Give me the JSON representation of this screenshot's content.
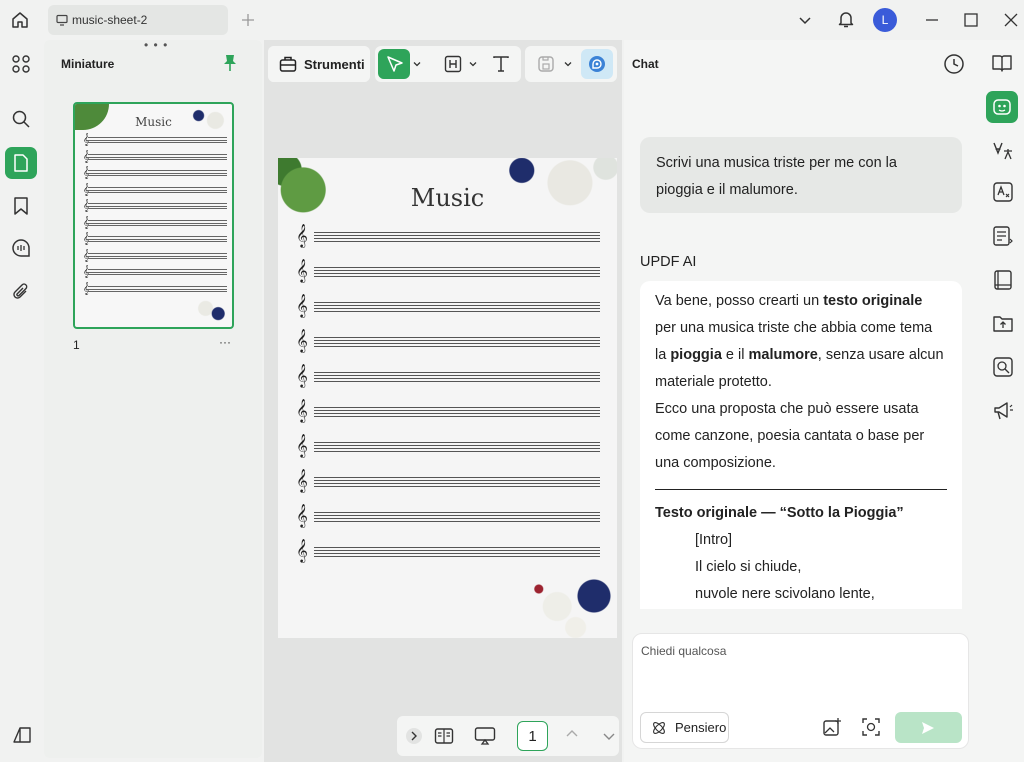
{
  "tab": {
    "title": "music-sheet-2"
  },
  "thumbnails": {
    "title": "Miniature",
    "page_number": "1",
    "more": "···"
  },
  "toolbar": {
    "tools_label": "Strumenti"
  },
  "document": {
    "page_title": "Music",
    "clef": "𝄞",
    "staff_count": 10
  },
  "bottombar": {
    "page_value": "1"
  },
  "chat": {
    "title": "Chat",
    "user_message": "Scrivi una musica triste per me con la pioggia e il malumore.",
    "ai_label": "UPDF AI",
    "ai_p1_a": "Va bene, posso crearti un ",
    "ai_p1_b": "testo originale",
    "ai_p1_c": " per una musica triste che abbia come tema la ",
    "ai_p1_d": "pioggia",
    "ai_p1_e": " e il ",
    "ai_p1_f": "malumore",
    "ai_p1_g": ", senza usare alcun materiale protetto.",
    "ai_p2": "Ecco una proposta che può essere usata come canzone, poesia cantata o base per una composizione.",
    "ai_heading": "Testo originale — “Sotto la Pioggia”",
    "ai_intro": "[Intro]",
    "ai_line1": "Il cielo si chiude,",
    "ai_line2": "nuvole nere scivolano lente,",
    "input_placeholder": "Chiedi qualcosa",
    "think_label": "Pensiero"
  },
  "user": {
    "avatar_initial": "L"
  },
  "colors": {
    "accent": "#2ea45a",
    "accent_light": "#b9e4c7",
    "avatar": "#3a5bd9"
  }
}
